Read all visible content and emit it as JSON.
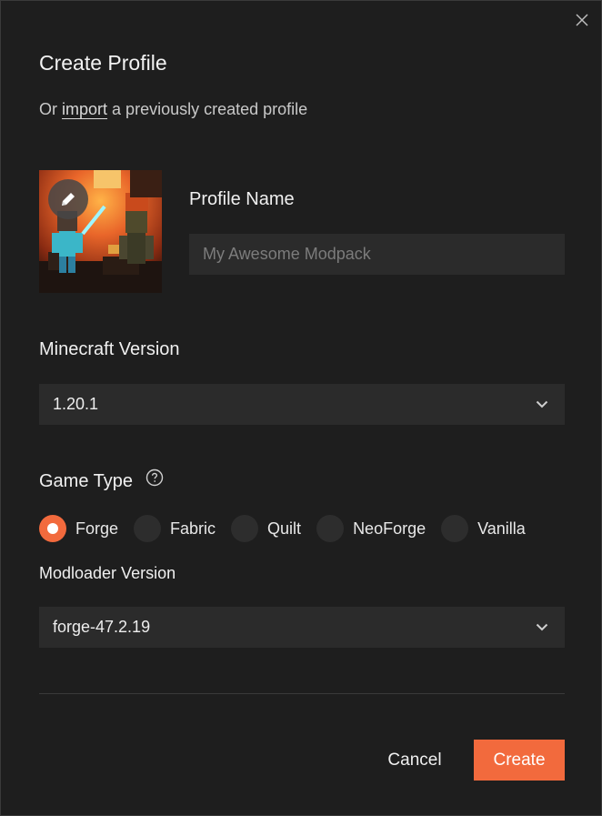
{
  "dialog": {
    "title": "Create Profile",
    "subtitle_prefix": "Or",
    "import_link": "import",
    "subtitle_suffix": "a previously created profile",
    "close_icon": "close-icon"
  },
  "avatar": {
    "edit_icon": "pencil-icon"
  },
  "profile_name": {
    "label": "Profile Name",
    "value": "",
    "placeholder": "My Awesome Modpack"
  },
  "minecraft_version": {
    "label": "Minecraft Version",
    "selected": "1.20.1"
  },
  "game_type": {
    "label": "Game Type",
    "help_icon": "help-circle-icon",
    "options": [
      {
        "label": "Forge",
        "checked": true
      },
      {
        "label": "Fabric",
        "checked": false
      },
      {
        "label": "Quilt",
        "checked": false
      },
      {
        "label": "NeoForge",
        "checked": false
      },
      {
        "label": "Vanilla",
        "checked": false
      }
    ]
  },
  "modloader_version": {
    "label": "Modloader Version",
    "selected": "forge-47.2.19"
  },
  "actions": {
    "cancel_label": "Cancel",
    "create_label": "Create"
  },
  "colors": {
    "accent": "#f26a3d",
    "background": "#1e1e1e",
    "input_bg": "#2b2b2b"
  }
}
